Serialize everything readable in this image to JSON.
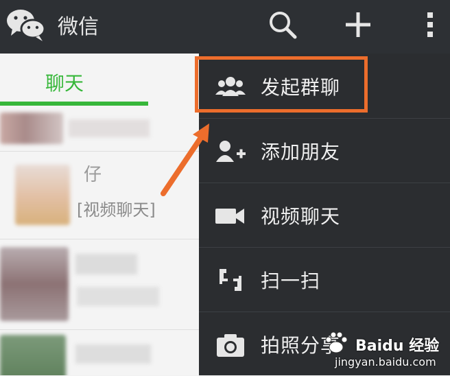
{
  "header": {
    "title": "微信",
    "icons": {
      "logo": "wechat-logo",
      "search": "search-icon",
      "plus": "plus-icon",
      "more": "more-vertical-icon"
    }
  },
  "chat_tab": {
    "label": "聊天",
    "accent_color": "#37b73a"
  },
  "chat_list": [
    {
      "name": "",
      "preview": ""
    },
    {
      "name": "仔",
      "preview": "[视频聊天]"
    },
    {
      "name": "",
      "preview": ""
    },
    {
      "name": "",
      "preview": ""
    }
  ],
  "menu": {
    "items": [
      {
        "label": "发起群聊",
        "icon": "group-icon"
      },
      {
        "label": "添加朋友",
        "icon": "add-friend-icon"
      },
      {
        "label": "视频聊天",
        "icon": "video-camera-icon"
      },
      {
        "label": "扫一扫",
        "icon": "scan-icon"
      },
      {
        "label": "拍照分享",
        "icon": "camera-icon"
      }
    ]
  },
  "annotation": {
    "highlight_color": "#ec6d2c"
  },
  "watermark": {
    "brand": "Baidu 经验",
    "url": "jingyan.baidu.com"
  }
}
